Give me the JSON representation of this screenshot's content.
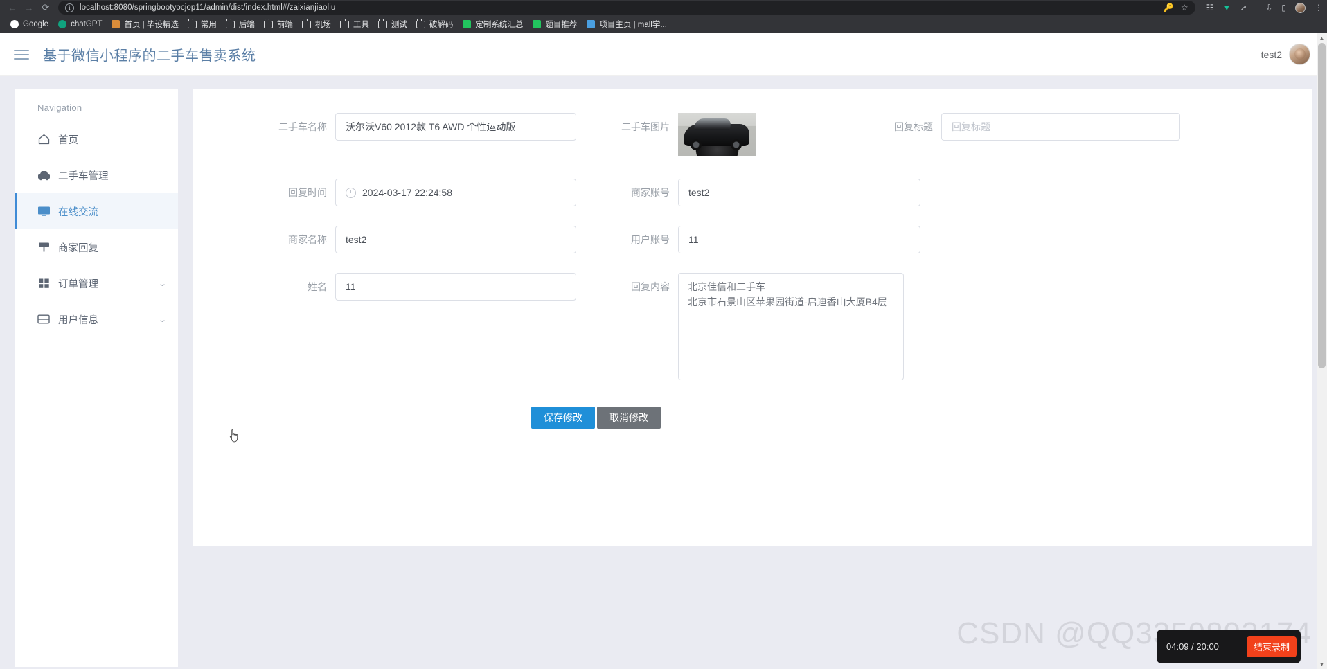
{
  "browser": {
    "back_icon": "back-arrow-icon",
    "forward_icon": "forward-arrow-icon",
    "reload_icon": "reload-icon",
    "url": "localhost:8080/springbootyocjop11/admin/dist/index.html#/zaixianjiaoliu",
    "omnibox_icons": [
      "password-key-icon",
      "bookmark-star-icon"
    ],
    "toolbar_icons": [
      "extensions-icon",
      "vue-devtools-icon",
      "share-icon",
      "download-icon",
      "side-panel-icon",
      "profile-avatar-icon",
      "chrome-menu-icon"
    ],
    "bookmarks": [
      {
        "label": "Google",
        "icon": "google-icon",
        "type": "site",
        "color": "#ffffff"
      },
      {
        "label": "chatGPT",
        "icon": "chatgpt-icon",
        "type": "site",
        "color": "#10a37f"
      },
      {
        "label": "首页 | 毕设精选",
        "icon": "site-icon",
        "type": "site",
        "color": "#d98c3a"
      },
      {
        "label": "常用",
        "icon": "folder-icon",
        "type": "folder"
      },
      {
        "label": "后端",
        "icon": "folder-icon",
        "type": "folder"
      },
      {
        "label": "前端",
        "icon": "folder-icon",
        "type": "folder"
      },
      {
        "label": "机场",
        "icon": "folder-icon",
        "type": "folder"
      },
      {
        "label": "工具",
        "icon": "folder-icon",
        "type": "folder"
      },
      {
        "label": "测试",
        "icon": "folder-icon",
        "type": "folder"
      },
      {
        "label": "破解码",
        "icon": "folder-icon",
        "type": "folder"
      },
      {
        "label": "定制系统汇总",
        "icon": "site-icon",
        "type": "site",
        "color": "#22c55e"
      },
      {
        "label": "题目推荐",
        "icon": "site-icon",
        "type": "site",
        "color": "#22c55e"
      },
      {
        "label": "项目主页 | mall学...",
        "icon": "site-icon",
        "type": "site",
        "color": "#4a9fe0"
      }
    ]
  },
  "header": {
    "menu_icon": "hamburger-menu-icon",
    "title": "基于微信小程序的二手车售卖系统",
    "user_name": "test2",
    "avatar_icon": "user-avatar-icon"
  },
  "sidebar": {
    "section_title": "Navigation",
    "items": [
      {
        "label": "首页",
        "icon": "home-icon",
        "active": false,
        "expandable": false
      },
      {
        "label": "二手车管理",
        "icon": "car-icon",
        "active": false,
        "expandable": false
      },
      {
        "label": "在线交流",
        "icon": "monitor-icon",
        "active": true,
        "expandable": false
      },
      {
        "label": "商家回复",
        "icon": "reply-icon",
        "active": false,
        "expandable": false
      },
      {
        "label": "订单管理",
        "icon": "grid-icon",
        "active": false,
        "expandable": true
      },
      {
        "label": "用户信息",
        "icon": "id-card-icon",
        "active": false,
        "expandable": true
      }
    ],
    "chevron_icon": "chevron-down-icon"
  },
  "form": {
    "car_name": {
      "label": "二手车名称",
      "value": "沃尔沃V60 2012款 T6 AWD 个性运动版"
    },
    "car_image": {
      "label": "二手车图片",
      "alt": "car-thumbnail"
    },
    "reply_title": {
      "label": "回复标题",
      "value": "",
      "placeholder": "回复标题"
    },
    "reply_time": {
      "label": "回复时间",
      "value": "2024-03-17 22:24:58",
      "icon": "clock-icon"
    },
    "merchant_account": {
      "label": "商家账号",
      "value": "test2"
    },
    "merchant_name": {
      "label": "商家名称",
      "value": "test2"
    },
    "user_account": {
      "label": "用户账号",
      "value": "11"
    },
    "full_name": {
      "label": "姓名",
      "value": "11"
    },
    "reply_content": {
      "label": "回复内容",
      "value": "北京佳信和二手车\n北京市石景山区苹果园街道-启迪香山大厦B4层"
    },
    "save_button": "保存修改",
    "cancel_button": "取消修改"
  },
  "overlay": {
    "watermark": "CSDN @QQ3359892174",
    "recording_time": "04:09 / 20:00",
    "stop_button": "结束录制"
  },
  "colors": {
    "accent": "#1f8fd8",
    "sidebar_active": "#4b8ec9",
    "page_bg": "#eaebf2",
    "stop_red": "#f2411b"
  }
}
